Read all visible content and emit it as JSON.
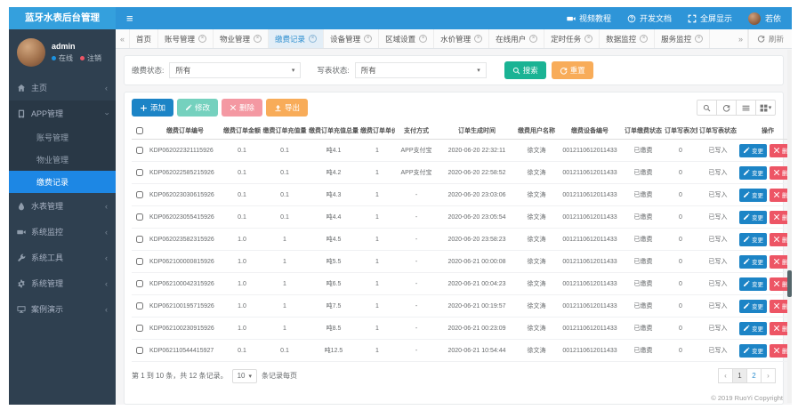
{
  "brand": {
    "title": "蓝牙水表后台管理"
  },
  "navbar": {
    "items": [
      {
        "icon": "video",
        "label": "视频教程"
      },
      {
        "icon": "question",
        "label": "开发文档"
      },
      {
        "icon": "expand",
        "label": "全屏显示"
      }
    ],
    "user_name": "若依"
  },
  "sidebar": {
    "user": {
      "name": "admin",
      "online_label": "在线",
      "logout_label": "注销"
    },
    "menu": [
      {
        "icon": "home",
        "label": "主页",
        "state": "collapsed"
      },
      {
        "icon": "app",
        "label": "APP管理",
        "state": "expanded",
        "children": [
          {
            "label": "账号管理",
            "active": false
          },
          {
            "label": "物业管理",
            "active": false
          },
          {
            "label": "缴费记录",
            "active": true
          }
        ]
      },
      {
        "icon": "droplet",
        "label": "水表管理",
        "state": "collapsed"
      },
      {
        "icon": "monitor",
        "label": "系统监控",
        "state": "collapsed"
      },
      {
        "icon": "wrench",
        "label": "系统工具",
        "state": "collapsed"
      },
      {
        "icon": "gear",
        "label": "系统管理",
        "state": "collapsed"
      },
      {
        "icon": "desktop",
        "label": "案例演示",
        "state": "collapsed"
      }
    ]
  },
  "tabs": {
    "items": [
      {
        "label": "首页",
        "closable": false,
        "active": false
      },
      {
        "label": "账号管理",
        "closable": true,
        "active": false
      },
      {
        "label": "物业管理",
        "closable": true,
        "active": false
      },
      {
        "label": "缴费记录",
        "closable": true,
        "active": true
      },
      {
        "label": "设备管理",
        "closable": true,
        "active": false
      },
      {
        "label": "区域设置",
        "closable": true,
        "active": false
      },
      {
        "label": "水价管理",
        "closable": true,
        "active": false
      },
      {
        "label": "在线用户",
        "closable": true,
        "active": false
      },
      {
        "label": "定时任务",
        "closable": true,
        "active": false
      },
      {
        "label": "数据监控",
        "closable": true,
        "active": false
      },
      {
        "label": "服务监控",
        "closable": true,
        "active": false
      }
    ],
    "refresh_label": "刷新"
  },
  "filters": {
    "payment_status_label": "缴费状态:",
    "payment_status_value": "所有",
    "write_status_label": "写表状态:",
    "write_status_value": "所有",
    "search_label": "搜索",
    "reset_label": "重置"
  },
  "toolbar": {
    "add_label": "添加",
    "edit_label": "修改",
    "delete_label": "删除",
    "export_label": "导出"
  },
  "table": {
    "columns": [
      "缴费订单编号",
      "缴费订单金额",
      "缴费订单充值量",
      "缴费订单充值总量",
      "缴费订单单价",
      "支付方式",
      "订单生成时间",
      "缴费用户名称",
      "缴费设备编号",
      "订单缴费状态",
      "订单写表次数",
      "订单写表状态",
      "操作"
    ],
    "rows": [
      [
        "KDP062022321115926",
        "0.1",
        "0.1",
        "吨4.1",
        "1",
        "APP支付宝",
        "2020-06-20 22:32:11",
        "徐文涛",
        "0012110612011433",
        "已缴费",
        "0",
        "已写入"
      ],
      [
        "KDP062022585215926",
        "0.1",
        "0.1",
        "吨4.2",
        "1",
        "APP支付宝",
        "2020-06-20 22:58:52",
        "徐文涛",
        "0012110612011433",
        "已缴费",
        "0",
        "已写入"
      ],
      [
        "KDP062023030615926",
        "0.1",
        "0.1",
        "吨4.3",
        "1",
        "-",
        "2020-06-20 23:03:06",
        "徐文涛",
        "0012110612011433",
        "已缴费",
        "0",
        "已写入"
      ],
      [
        "KDP062023055415926",
        "0.1",
        "0.1",
        "吨4.4",
        "1",
        "-",
        "2020-06-20 23:05:54",
        "徐文涛",
        "0012110612011433",
        "已缴费",
        "0",
        "已写入"
      ],
      [
        "KDP062023582315926",
        "1.0",
        "1",
        "吨4.5",
        "1",
        "-",
        "2020-06-20 23:58:23",
        "徐文涛",
        "0012110612011433",
        "已缴费",
        "0",
        "已写入"
      ],
      [
        "KDP062100000815926",
        "1.0",
        "1",
        "吨5.5",
        "1",
        "-",
        "2020-06-21 00:00:08",
        "徐文涛",
        "0012110612011433",
        "已缴费",
        "0",
        "已写入"
      ],
      [
        "KDP062100042315926",
        "1.0",
        "1",
        "吨6.5",
        "1",
        "-",
        "2020-06-21 00:04:23",
        "徐文涛",
        "0012110612011433",
        "已缴费",
        "0",
        "已写入"
      ],
      [
        "KDP062100195715926",
        "1.0",
        "1",
        "吨7.5",
        "1",
        "-",
        "2020-06-21 00:19:57",
        "徐文涛",
        "0012110612011433",
        "已缴费",
        "0",
        "已写入"
      ],
      [
        "KDP062100230915926",
        "1.0",
        "1",
        "吨8.5",
        "1",
        "-",
        "2020-06-21 00:23:09",
        "徐文涛",
        "0012110612011433",
        "已缴费",
        "0",
        "已写入"
      ],
      [
        "KDP062110544415927",
        "0.1",
        "0.1",
        "吨12.5",
        "1",
        "-",
        "2020-06-21 10:54:44",
        "徐文涛",
        "0012110612011433",
        "已缴费",
        "0",
        "已写入"
      ]
    ],
    "row_action_edit": "变更",
    "row_action_delete": "删除"
  },
  "pagination": {
    "info_prefix": "第 1 到 10 条，共 12 条记录。",
    "page_size": "10",
    "info_suffix": "条记录每页",
    "pages": [
      "1",
      "2"
    ],
    "active_page": "1"
  },
  "footer": {
    "copyright": "© 2019 RuoYi Copyright"
  },
  "colors": {
    "navbar": "#2e95d8",
    "brand": "#34a0dd",
    "sidebar": "#2f4050",
    "active_menu": "#1d87e4",
    "primary": "#1c84c6",
    "success": "#1ab394",
    "warning": "#f8ac59",
    "danger": "#ed5565"
  }
}
